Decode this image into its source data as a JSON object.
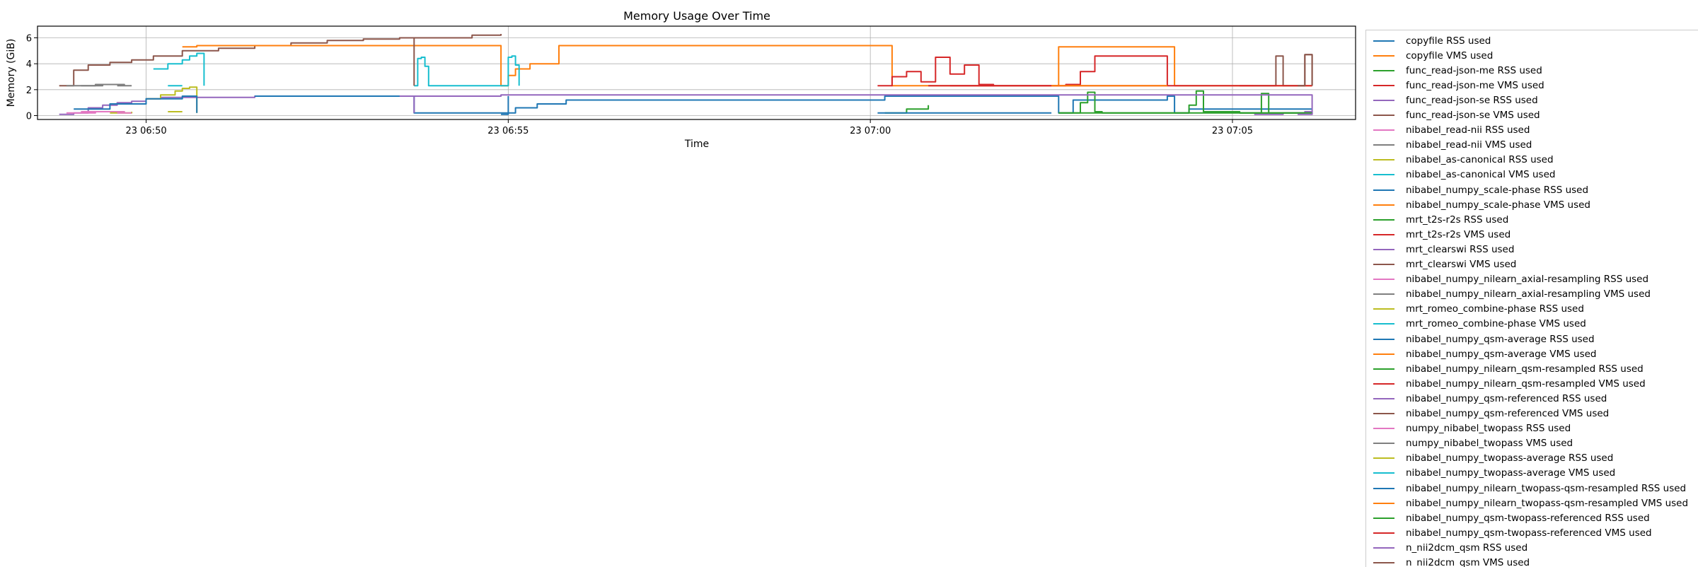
{
  "chart_data": {
    "type": "line",
    "title": "Memory Usage Over Time",
    "xlabel": "Time",
    "ylabel": "Memory (GiB)",
    "x_unit": "minutes after 06:48",
    "xlim": [
      0,
      18.2
    ],
    "ylim": [
      -0.3,
      6.9
    ],
    "yticks": [
      0,
      2,
      4,
      6
    ],
    "xticks": [
      {
        "value": 1.5,
        "label": "23 06:50"
      },
      {
        "value": 6.5,
        "label": "23 06:55"
      },
      {
        "value": 11.5,
        "label": "23 07:00"
      },
      {
        "value": 16.5,
        "label": "23 07:05"
      }
    ],
    "grid": true,
    "legend_location": "upper-left-outside-right",
    "series": [
      {
        "name": "copyfile RSS used",
        "color": "#1f77b4",
        "x": [
          6.4,
          6.5,
          6.6,
          6.9,
          7.3,
          11.6,
          11.7,
          11.8,
          14.0,
          14.1,
          14.3,
          15.6,
          15.7,
          15.9,
          17.6
        ],
        "y": [
          0.1,
          0.2,
          0.6,
          0.9,
          1.2,
          1.2,
          1.5,
          1.5,
          1.5,
          0.2,
          1.2,
          1.5,
          0.2,
          0.5,
          0.5
        ]
      },
      {
        "name": "copyfile VMS used",
        "color": "#ff7f0e",
        "x": [
          6.4,
          6.5,
          6.6,
          6.8,
          7.2,
          11.6,
          11.7,
          11.8,
          14.0,
          14.1,
          14.3,
          15.6,
          15.7,
          15.9,
          17.6
        ],
        "y": [
          2.3,
          3.1,
          3.6,
          4.0,
          5.4,
          5.4,
          5.4,
          2.3,
          2.3,
          5.3,
          5.3,
          5.3,
          2.3,
          2.3,
          2.3
        ]
      },
      {
        "name": "func_read-json-me RSS used",
        "color": "#2ca02c",
        "x": [
          14.1,
          14.3,
          14.4,
          14.5,
          14.6,
          14.7,
          15.0,
          15.8,
          15.9,
          16.0,
          16.1,
          16.6,
          16.9,
          17.0,
          17.6
        ],
        "y": [
          0.2,
          0.2,
          1.0,
          1.8,
          0.3,
          0.2,
          0.2,
          0.2,
          0.8,
          1.9,
          0.3,
          0.2,
          1.7,
          0.2,
          0.2
        ]
      },
      {
        "name": "func_read-json-me VMS used",
        "color": "#d62728",
        "x": [
          11.6,
          11.8,
          12.0,
          12.2,
          12.4,
          12.6,
          12.8,
          13.0,
          13.2,
          13.4,
          13.6,
          14.2,
          14.4,
          14.6,
          15.6
        ],
        "y": [
          2.3,
          3.0,
          3.4,
          2.6,
          4.5,
          3.2,
          3.9,
          2.4,
          2.3,
          2.3,
          2.3,
          2.4,
          3.4,
          4.6,
          2.3
        ]
      },
      {
        "name": "func_read-json-se RSS used",
        "color": "#9467bd",
        "x": [
          0.3,
          0.5,
          0.7,
          0.9,
          1.1,
          1.3,
          1.5,
          1.7,
          2.0,
          2.5,
          3.0,
          3.5,
          5.0,
          6.4,
          17.6
        ],
        "y": [
          0.1,
          0.2,
          0.6,
          0.8,
          1.0,
          1.1,
          1.3,
          1.4,
          1.4,
          1.4,
          1.5,
          1.5,
          1.5,
          1.6,
          0.3
        ]
      },
      {
        "name": "func_read-json-se VMS used",
        "color": "#8c564b",
        "x": [
          0.3,
          0.5,
          0.7,
          1.0,
          1.3,
          1.6,
          2.0,
          2.5,
          3.0,
          3.5,
          4.0,
          4.5,
          5.0,
          6.0,
          6.4
        ],
        "y": [
          2.3,
          3.5,
          3.9,
          4.1,
          4.3,
          4.6,
          5.0,
          5.2,
          5.4,
          5.6,
          5.8,
          5.9,
          6.0,
          6.2,
          6.3
        ]
      },
      {
        "name": "nibabel_read-nii RSS used",
        "color": "#e377c2",
        "x": [
          0.4,
          0.8,
          1.2
        ],
        "y": [
          0.2,
          0.3,
          0.2
        ]
      },
      {
        "name": "nibabel_read-nii VMS used",
        "color": "#7f7f7f",
        "x": [
          0.4,
          0.8,
          1.2
        ],
        "y": [
          2.3,
          2.4,
          2.3
        ]
      },
      {
        "name": "nibabel_as-canonical RSS used",
        "color": "#bcbd22",
        "x": [
          1.5,
          1.7,
          1.9,
          2.0,
          2.1,
          2.2
        ],
        "y": [
          1.3,
          1.6,
          1.9,
          2.1,
          2.2,
          0.2
        ]
      },
      {
        "name": "nibabel_as-canonical VMS used",
        "color": "#17becf",
        "x": [
          1.6,
          1.8,
          2.0,
          2.1,
          2.2,
          2.3
        ],
        "y": [
          3.6,
          4.0,
          4.3,
          4.6,
          4.8,
          2.3
        ]
      },
      {
        "name": "nibabel_numpy_scale-phase RSS used",
        "color": "#1f77b4",
        "x": [
          0.5,
          1.0,
          1.5,
          2.0,
          2.2
        ],
        "y": [
          0.5,
          0.9,
          1.3,
          1.5,
          0.2
        ]
      },
      {
        "name": "nibabel_numpy_scale-phase VMS used",
        "color": "#ff7f0e",
        "x": [
          2.0,
          2.2,
          3.0,
          4.0,
          5.0,
          6.3,
          6.4
        ],
        "y": [
          5.3,
          5.4,
          5.4,
          5.4,
          5.4,
          5.4,
          2.3
        ]
      },
      {
        "name": "mrt_t2s-r2s RSS used",
        "color": "#2ca02c",
        "x": [
          11.7,
          12.0,
          12.3
        ],
        "y": [
          0.2,
          0.5,
          0.8
        ]
      },
      {
        "name": "mrt_t2s-r2s VMS used",
        "color": "#d62728",
        "x": [
          12.6,
          12.9,
          13.2
        ],
        "y": [
          2.3,
          2.3,
          2.3
        ]
      },
      {
        "name": "mrt_clearswi RSS used",
        "color": "#9467bd",
        "x": [
          16.8,
          17.2,
          17.5,
          17.6
        ],
        "y": [
          0.1,
          0.2,
          0.3,
          0.1
        ]
      },
      {
        "name": "mrt_clearswi VMS used",
        "color": "#8c564b",
        "x": [
          16.8,
          17.0,
          17.1,
          17.2,
          17.4,
          17.5,
          17.6
        ],
        "y": [
          2.3,
          2.3,
          4.6,
          2.3,
          2.3,
          4.7,
          2.3
        ]
      },
      {
        "name": "nibabel_numpy_nilearn_axial-resampling RSS used",
        "color": "#e377c2",
        "x": [
          0.6,
          0.9
        ],
        "y": [
          0.3,
          0.3
        ]
      },
      {
        "name": "nibabel_numpy_nilearn_axial-resampling VMS used",
        "color": "#7f7f7f",
        "x": [
          0.6,
          0.9
        ],
        "y": [
          2.3,
          2.4
        ]
      },
      {
        "name": "mrt_romeo_combine-phase RSS used",
        "color": "#bcbd22",
        "x": [
          1.0,
          1.3
        ],
        "y": [
          0.2,
          0.3
        ]
      },
      {
        "name": "mrt_romeo_combine-phase VMS used",
        "color": "#17becf",
        "x": [
          5.2,
          5.25,
          5.3,
          5.35,
          5.4,
          6.45,
          6.5,
          6.55,
          6.6,
          6.65
        ],
        "y": [
          2.3,
          4.4,
          4.5,
          3.8,
          2.3,
          2.3,
          4.5,
          4.6,
          3.9,
          2.3
        ]
      },
      {
        "name": "nibabel_numpy_qsm-average RSS used",
        "color": "#1f77b4",
        "x": [
          3.0,
          5.0,
          5.2,
          6.5
        ],
        "y": [
          1.5,
          1.5,
          0.2,
          1.5
        ]
      },
      {
        "name": "nibabel_numpy_qsm-average VMS used",
        "color": "#ff7f0e",
        "x": [
          5.2,
          5.6,
          6.4
        ],
        "y": [
          5.4,
          5.4,
          5.4
        ]
      },
      {
        "name": "nibabel_numpy_nilearn_qsm-resampled RSS used",
        "color": "#2ca02c",
        "x": [
          14.1,
          17.5
        ],
        "y": [
          0.2,
          0.2
        ]
      },
      {
        "name": "nibabel_numpy_nilearn_qsm-resampled VMS used",
        "color": "#d62728",
        "x": [
          12.3,
          16.8
        ],
        "y": [
          2.3,
          2.3
        ]
      },
      {
        "name": "nibabel_numpy_qsm-referenced RSS used",
        "color": "#9467bd",
        "x": [
          5.0,
          5.2
        ],
        "y": [
          1.5,
          0.2
        ]
      },
      {
        "name": "nibabel_numpy_qsm-referenced VMS used",
        "color": "#8c564b",
        "x": [
          5.1,
          5.2
        ],
        "y": [
          6.0,
          2.3
        ]
      },
      {
        "name": "numpy_nibabel_twopass RSS used",
        "color": "#e377c2",
        "x": [
          1.1,
          1.3
        ],
        "y": [
          0.2,
          0.2
        ]
      },
      {
        "name": "numpy_nibabel_twopass VMS used",
        "color": "#7f7f7f",
        "x": [
          1.1,
          1.3
        ],
        "y": [
          2.3,
          2.3
        ]
      },
      {
        "name": "nibabel_numpy_twopass-average RSS used",
        "color": "#bcbd22",
        "x": [
          1.8,
          2.0
        ],
        "y": [
          0.3,
          0.3
        ]
      },
      {
        "name": "nibabel_numpy_twopass-average VMS used",
        "color": "#17becf",
        "x": [
          1.8,
          2.0
        ],
        "y": [
          2.3,
          2.3
        ]
      },
      {
        "name": "nibabel_numpy_nilearn_twopass-qsm-resampled RSS used",
        "color": "#1f77b4",
        "x": [
          11.6,
          14.0
        ],
        "y": [
          0.2,
          0.2
        ]
      },
      {
        "name": "nibabel_numpy_nilearn_twopass-qsm-resampled VMS used",
        "color": "#ff7f0e",
        "x": [
          14.0,
          15.6
        ],
        "y": [
          2.3,
          2.3
        ]
      },
      {
        "name": "nibabel_numpy_qsm-twopass-referenced RSS used",
        "color": "#2ca02c",
        "x": [
          16.6,
          17.6
        ],
        "y": [
          0.2,
          0.2
        ]
      },
      {
        "name": "nibabel_numpy_qsm-twopass-referenced VMS used",
        "color": "#d62728",
        "x": [
          16.6,
          17.6
        ],
        "y": [
          2.3,
          2.3
        ]
      },
      {
        "name": "n_nii2dcm_qsm RSS used",
        "color": "#9467bd",
        "x": [
          17.4,
          17.6
        ],
        "y": [
          0.1,
          0.2
        ]
      },
      {
        "name": "n_nii2dcm_qsm VMS used",
        "color": "#8c564b",
        "x": [
          17.4,
          17.5,
          17.6
        ],
        "y": [
          2.3,
          4.7,
          2.3
        ]
      }
    ]
  }
}
